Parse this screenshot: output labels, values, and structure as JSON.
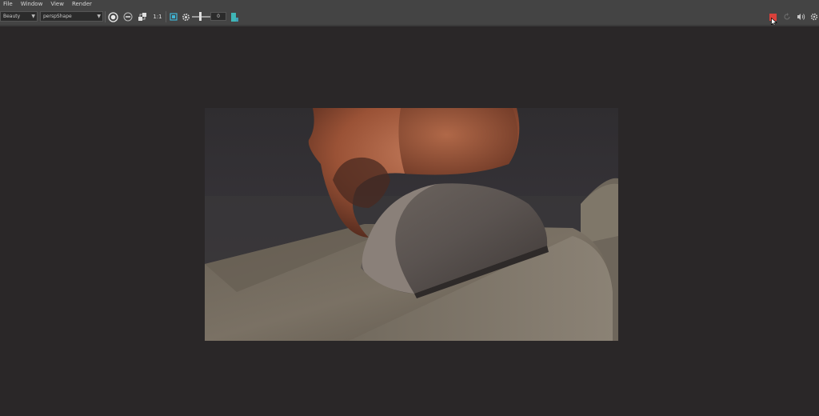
{
  "menu": [
    "File",
    "Window",
    "View",
    "Render"
  ],
  "toolbar": {
    "layer_select": "Beauty",
    "camera_select": "perspShape",
    "ratio_label": "1:1",
    "exposure_value": "0"
  },
  "icons": {
    "exposure": "aperture-icon",
    "grade": "rgb-icon",
    "snapshot": "checker-icon",
    "region": "crop-region-icon",
    "gamma": "gear-icon",
    "save": "save-icon",
    "stop": "stop-render-icon",
    "refresh": "refresh-icon",
    "sound": "sound-icon",
    "settings": "settings-gear-icon"
  },
  "colors": {
    "stop_button": "#d8413b",
    "accent_teal": "#3fb6b6"
  }
}
